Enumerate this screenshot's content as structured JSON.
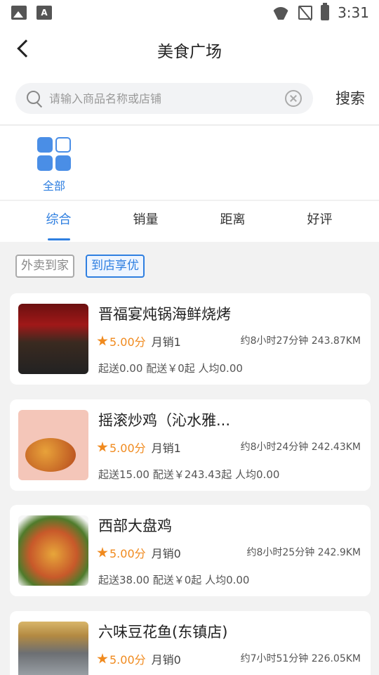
{
  "status_bar": {
    "time": "3:31"
  },
  "header": {
    "title": "美食广场"
  },
  "search": {
    "placeholder": "请输入商品名称或店铺",
    "button_label": "搜索"
  },
  "categories": [
    {
      "label": "全部"
    }
  ],
  "sort_tabs": [
    {
      "label": "综合",
      "active": true
    },
    {
      "label": "销量"
    },
    {
      "label": "距离"
    },
    {
      "label": "好评"
    }
  ],
  "filters": [
    {
      "label": "外卖到家",
      "active": false
    },
    {
      "label": "到店享优",
      "active": true
    }
  ],
  "shops": [
    {
      "name": "晋福宴炖锅海鲜烧烤",
      "rating": "5.00分",
      "sales": "月销1",
      "distance": "约8小时27分钟 243.87KM",
      "min_order": "起送0.00",
      "delivery_fee": "配送￥0起",
      "avg_price": "人均0.00"
    },
    {
      "name": "摇滚炒鸡（沁水雅...",
      "rating": "5.00分",
      "sales": "月销1",
      "distance": "约8小时24分钟 242.43KM",
      "min_order": "起送15.00",
      "delivery_fee": "配送￥243.43起",
      "avg_price": "人均0.00"
    },
    {
      "name": "西部大盘鸡",
      "rating": "5.00分",
      "sales": "月销0",
      "distance": "约8小时25分钟 242.9KM",
      "min_order": "起送38.00",
      "delivery_fee": "配送￥0起",
      "avg_price": "人均0.00"
    },
    {
      "name": "六味豆花鱼(东镇店)",
      "rating": "5.00分",
      "sales": "月销0",
      "distance": "约7小时51分钟 226.05KM",
      "min_order": "",
      "delivery_fee": "",
      "avg_price": ""
    }
  ],
  "colors": {
    "accent": "#2f7fe0",
    "rating": "#f08a1e"
  }
}
